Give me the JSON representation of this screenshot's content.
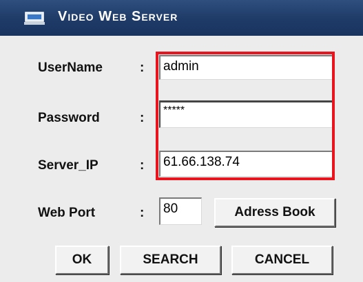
{
  "window": {
    "title": "Video Web Server",
    "icon": "monitor-icon"
  },
  "form": {
    "username": {
      "label": "UserName",
      "value": "admin"
    },
    "password": {
      "label": "Password",
      "value": "*****"
    },
    "server_ip": {
      "label": "Server_IP",
      "value": "61.66.138.74"
    },
    "web_port": {
      "label": "Web Port",
      "value": "80"
    },
    "separator": ":"
  },
  "buttons": {
    "address_book": "Adress Book",
    "ok": "OK",
    "search": "SEARCH",
    "cancel": "CANCEL"
  },
  "colors": {
    "titlebar": "#1e3a66",
    "highlight": "#e8141e",
    "background": "#ececec"
  }
}
